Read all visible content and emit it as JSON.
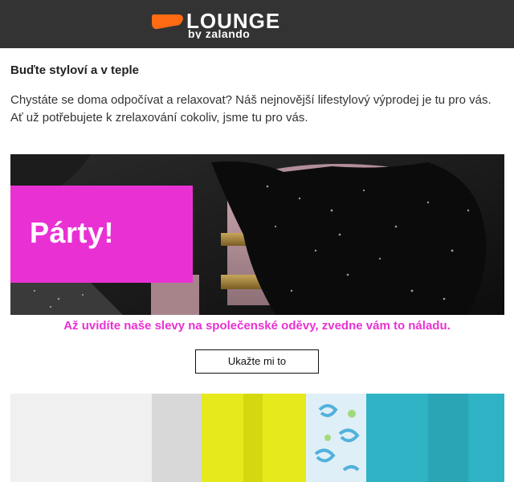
{
  "brand": {
    "name": "LOUNGE",
    "sub": "by zalando",
    "colors": {
      "header_bg": "#333333",
      "accent_orange": "#ff6a13",
      "accent_pink": "#e931d3"
    }
  },
  "intro": {
    "title": "Buďte styloví a v teple",
    "text": "Chystáte se doma odpočívat a relaxovat? Náš nejnovější lifestylový výprodej je tu pro vás. Ať už potřebujete k zrelaxování cokoliv, jsme tu pro vás."
  },
  "promo": {
    "label": "Párty!",
    "tagline": "Až uvidíte naše slevy na společenské oděvy, zvedne vám to náladu.",
    "cta": "Ukažte mi to"
  }
}
